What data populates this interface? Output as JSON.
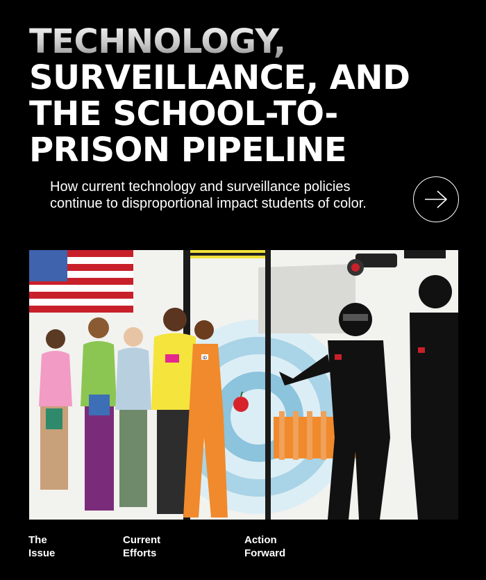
{
  "header": {
    "title_lines": [
      "TECHNOLOGY,",
      "SURVEILLANCE, AND",
      "THE SCHOOL-TO-",
      "PRISON PIPELINE"
    ],
    "subtitle": "How current technology and surveillance policies continue to disproportional impact students of color."
  },
  "next_button": {
    "icon": "arrow-right-icon"
  },
  "illustration": {
    "description_icon": "school-to-prison-illustration",
    "student_badge": "ID",
    "colors": {
      "flag_red": "#c8202a",
      "orange": "#f08a2c",
      "blue_target": "#6fb6d9",
      "police_black": "#111111",
      "yellow": "#f3e03a"
    }
  },
  "nav": [
    {
      "line1": "The",
      "line2": "Issue"
    },
    {
      "line1": "Current",
      "line2": "Efforts"
    },
    {
      "line1": "Action",
      "line2": "Forward"
    }
  ]
}
